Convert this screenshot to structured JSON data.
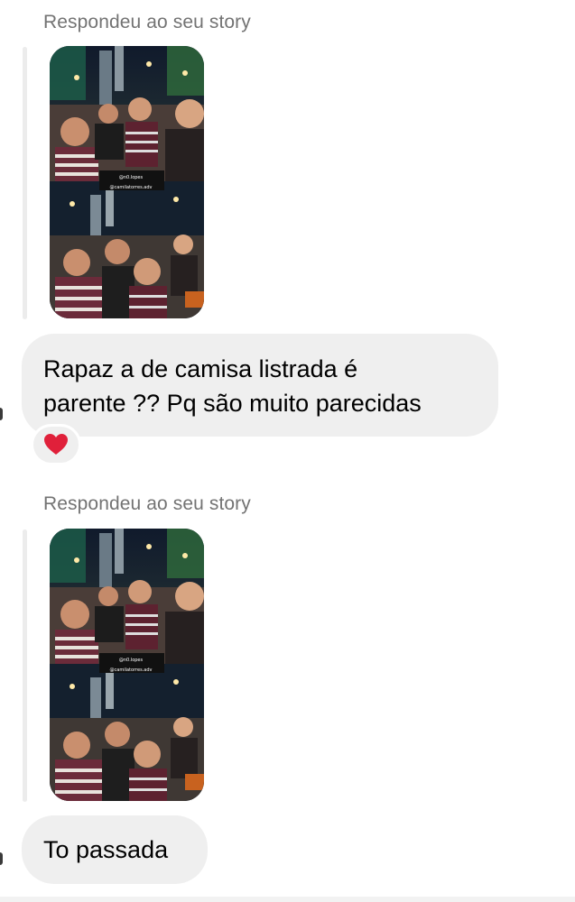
{
  "messages": [
    {
      "type": "story_reply",
      "reply_label": "Respondeu ao seu story",
      "story_caption_lines": [
        "@n0.lopes",
        "@camilatorres.adv"
      ],
      "text_lines": [
        "Rapaz a de camisa listrada é",
        "parente ?? Pq são muito parecidas"
      ],
      "reaction": "heart"
    },
    {
      "type": "story_reply",
      "reply_label": "Respondeu ao seu story",
      "story_caption_lines": [
        "@n0.lopes",
        "@camilatorres.adv"
      ],
      "text_lines": [
        "To passada"
      ]
    }
  ],
  "colors": {
    "bubble_bg": "#efefef",
    "label_text": "#737373",
    "heart": "#e0203a"
  },
  "icons": {
    "reaction": "heart-icon"
  }
}
